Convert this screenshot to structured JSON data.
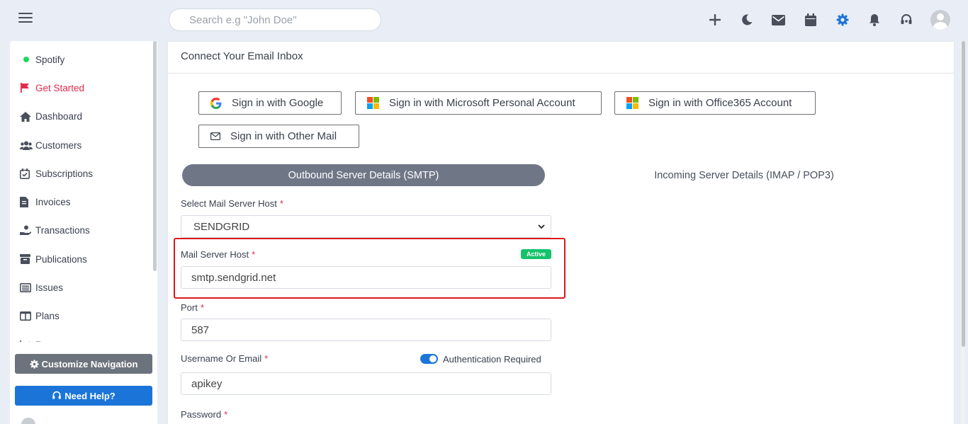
{
  "topbar": {
    "search_placeholder": "Search e.g \"John Doe\"",
    "icons": [
      "plus-icon",
      "moon-icon",
      "envelope-icon",
      "calendar-icon",
      "gear-icon",
      "bell-icon",
      "headset-icon",
      "avatar"
    ]
  },
  "sidebar": {
    "items": [
      {
        "label": "Spotify",
        "icon": "status-dot"
      },
      {
        "label": "Get Started",
        "icon": "flag-icon"
      },
      {
        "label": "Dashboard",
        "icon": "home-icon"
      },
      {
        "label": "Customers",
        "icon": "users-icon"
      },
      {
        "label": "Subscriptions",
        "icon": "calendar-check-icon"
      },
      {
        "label": "Invoices",
        "icon": "file-invoice-icon"
      },
      {
        "label": "Transactions",
        "icon": "hand-coin-icon"
      },
      {
        "label": "Publications",
        "icon": "archive-icon"
      },
      {
        "label": "Issues",
        "icon": "list-icon"
      },
      {
        "label": "Plans",
        "icon": "columns-icon"
      },
      {
        "label": "Reports",
        "icon": "chart-line-icon"
      }
    ],
    "customize_label": "Customize Navigation",
    "help_label": "Need Help?"
  },
  "main": {
    "title": "Connect Your Email Inbox",
    "signin": {
      "google": "Sign in with Google",
      "microsoft": "Sign in with Microsoft Personal Account",
      "office365": "Sign in with Office365 Account",
      "other": "Sign in with Other Mail"
    },
    "tabs": {
      "smtp": "Outbound Server Details (SMTP)",
      "imap": "Incoming Server Details (IMAP / POP3)"
    },
    "form": {
      "select_host_label": "Select Mail Server Host",
      "select_host_value": "SENDGRID",
      "host_label": "Mail Server Host",
      "host_status": "Active",
      "host_value": "smtp.sendgrid.net",
      "port_label": "Port",
      "port_value": "587",
      "username_label": "Username Or Email",
      "auth_label": "Authentication Required",
      "auth_enabled": true,
      "username_value": "apikey",
      "password_label": "Password",
      "required_marker": "*"
    }
  },
  "colors": {
    "accent": "#1b75d8",
    "danger": "#e3294b",
    "success": "#14c26a",
    "tab_active": "#6f7787",
    "highlight": "#d9191c"
  }
}
